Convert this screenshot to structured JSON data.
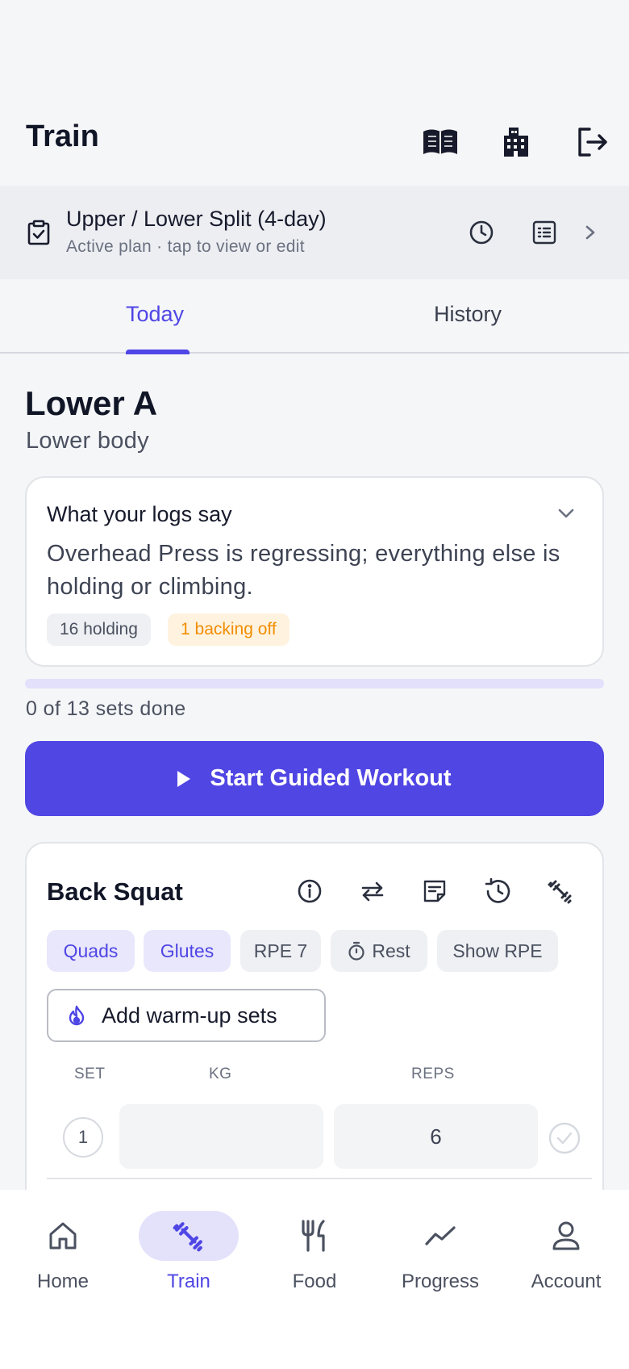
{
  "header": {
    "title": "Train"
  },
  "plan": {
    "title": "Upper / Lower Split (4-day)",
    "subtitle": "Active plan · tap to view or edit"
  },
  "tabs": [
    {
      "label": "Today"
    },
    {
      "label": "History"
    }
  ],
  "day": {
    "title": "Lower A",
    "subtitle": "Lower body"
  },
  "insight": {
    "heading": "What your logs say",
    "body": "Overhead Press is regressing; everything else is holding or climbing.",
    "chip_holding": "16 holding",
    "chip_backing": "1 backing off"
  },
  "progress": {
    "done": 0,
    "total": 13,
    "label": "0 of 13 sets done"
  },
  "start_button": "Start Guided Workout",
  "exercise": {
    "name": "Back Squat",
    "tags": [
      "Quads",
      "Glutes",
      "RPE 7",
      "Rest",
      "Show RPE"
    ],
    "warmup_button": "Add warm-up sets",
    "columns": {
      "set": "SET",
      "kg": "KG",
      "reps": "REPS"
    },
    "sets": [
      {
        "number": "1",
        "kg": "",
        "reps": "6"
      }
    ]
  },
  "nav": [
    {
      "label": "Home",
      "icon": "home-icon"
    },
    {
      "label": "Train",
      "icon": "dumbbell-icon"
    },
    {
      "label": "Food",
      "icon": "utensils-icon"
    },
    {
      "label": "Progress",
      "icon": "trend-icon"
    },
    {
      "label": "Account",
      "icon": "user-icon"
    }
  ],
  "colors": {
    "accent": "#4f46e5",
    "warning": "#f28c00"
  }
}
